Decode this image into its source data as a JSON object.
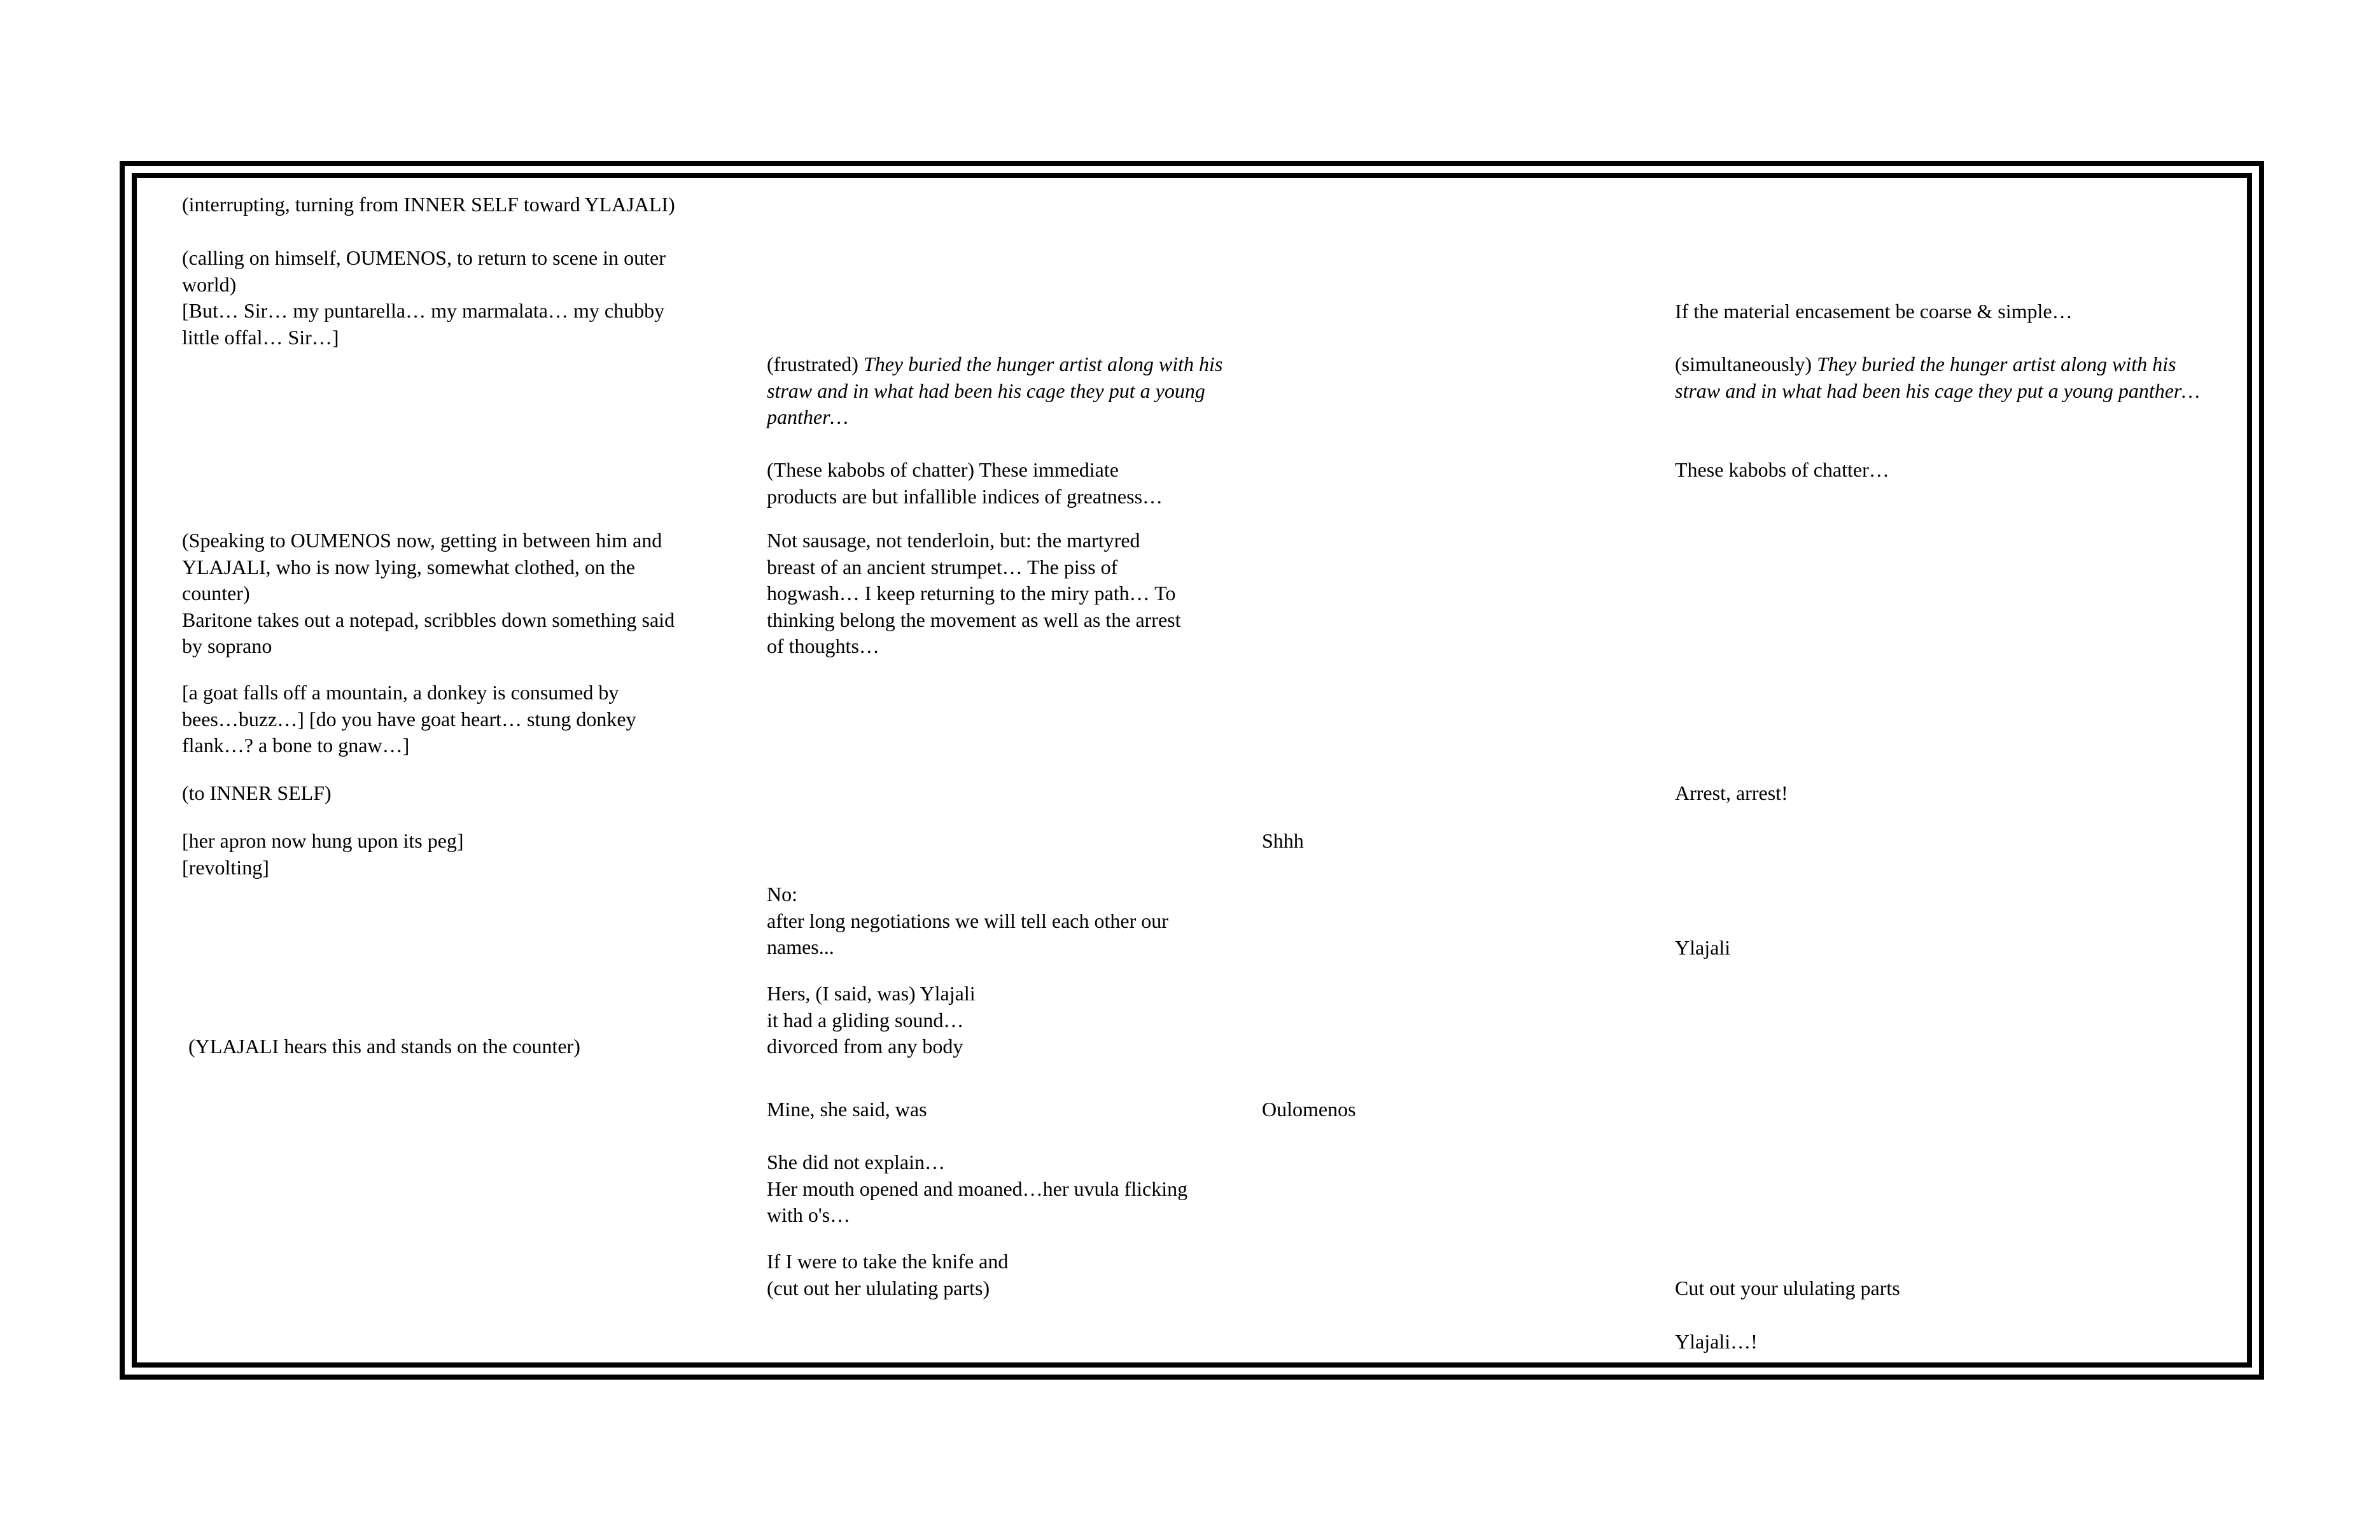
{
  "col1": {
    "b1": "(interrupting, turning from INNER SELF toward YLAJALI)",
    "b2": [
      "(calling on himself, OUMENOS, to return to scene in outer",
      "world)",
      "[But… Sir… my puntarella… my marmalata… my chubby",
      "little offal… Sir…]"
    ],
    "b3": [
      "(Speaking to OUMENOS now, getting in between him and",
      "YLAJALI, who is now lying, somewhat clothed, on the",
      "counter)",
      "Baritone takes out a notepad, scribbles down something said",
      "by soprano"
    ],
    "b4": [
      "[a goat falls off a mountain, a donkey is consumed by",
      "bees…buzz…] [do you have goat heart… stung donkey",
      "flank…? a bone to gnaw…]"
    ],
    "b5": "(to INNER SELF)",
    "b6": [
      "[her apron now hung upon its peg]",
      "[revolting]"
    ],
    "b7": "(YLAJALI hears this and stands on the counter)"
  },
  "col2": {
    "frustrated_prefix": "(frustrated) ",
    "frustrated_italic": [
      "They buried the hunger artist along with his",
      "straw and in what had been his cage they put a young",
      "panther…"
    ],
    "b2": [
      "(These kabobs of chatter) These immediate",
      "products are but infallible indices of greatness…"
    ],
    "b3": [
      "Not sausage, not tenderloin, but: the martyred",
      "breast of an ancient strumpet… The piss of",
      "hogwash… I keep returning to the miry path… To",
      "thinking belong the movement as well as the arrest",
      "of thoughts…"
    ],
    "b4": [
      "No:",
      "after long negotiations we will tell each other our",
      "names..."
    ],
    "b5": [
      "Hers, (I said, was) Ylajali",
      "it had a gliding sound…",
      "divorced from any body"
    ],
    "b6": "Mine, she said, was",
    "b7": [
      "She did not explain…",
      "Her mouth opened and moaned…her uvula flicking",
      "with o's…"
    ],
    "b8": [
      "If I were to take the knife and",
      "(cut out her ululating parts)"
    ]
  },
  "col3": {
    "shhh": "Shhh",
    "oulomenos": "Oulomenos"
  },
  "col4": {
    "b1": "If the material encasement be coarse & simple…",
    "simul_prefix": "(simultaneously) ",
    "simul_italic": [
      "They buried the hunger artist along with his",
      "straw and in what had been his cage they put a young panther…"
    ],
    "b3": "These kabobs of chatter…",
    "b4": "Arrest, arrest!",
    "b5": "Ylajali",
    "b6": "Cut out your ululating parts",
    "b7": "Ylajali…!"
  }
}
